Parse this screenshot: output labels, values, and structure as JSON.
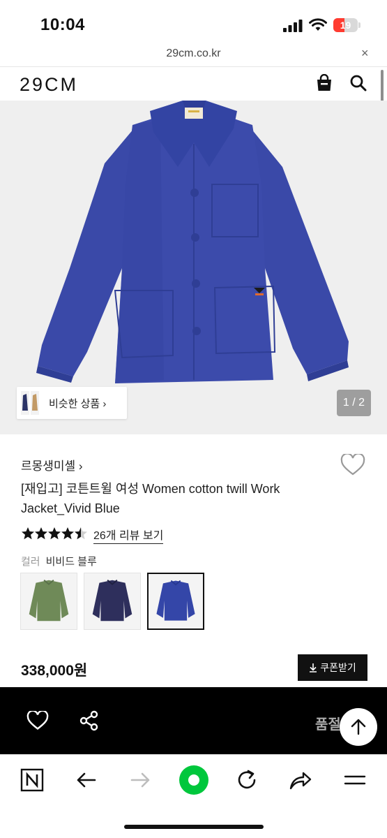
{
  "status_bar": {
    "time": "10:04",
    "battery": "19"
  },
  "browser": {
    "url": "29cm.co.kr",
    "close_icon": "×"
  },
  "header": {
    "logo": "29CM",
    "bag_icon": "shopping-bag-icon",
    "search_icon": "search-icon"
  },
  "gallery": {
    "similar_label": "비슷한 상품 ›",
    "counter": "1 / 2"
  },
  "product": {
    "brand": "르몽생미셸 ›",
    "title": "[재입고] 코튼트윌 여성 Women cotton twill Work Jacket_Vivid Blue",
    "rating": 4.5,
    "review_link": "26개 리뷰 보기",
    "color_key": "컬러",
    "color_value": "비비드 블루",
    "swatches": [
      {
        "name": "olive",
        "color": "#6f8a58",
        "selected": false
      },
      {
        "name": "navy",
        "color": "#2e2f5c",
        "selected": false
      },
      {
        "name": "vivid-blue",
        "color": "#3446a8",
        "selected": true
      }
    ],
    "price": "338,000원",
    "coupon_label": "쿠폰받기"
  },
  "buy_bar": {
    "status_text": "품절"
  },
  "colors": {
    "accent_green": "#00c73c",
    "jacket_blue": "#3a49a8",
    "black": "#000000"
  }
}
